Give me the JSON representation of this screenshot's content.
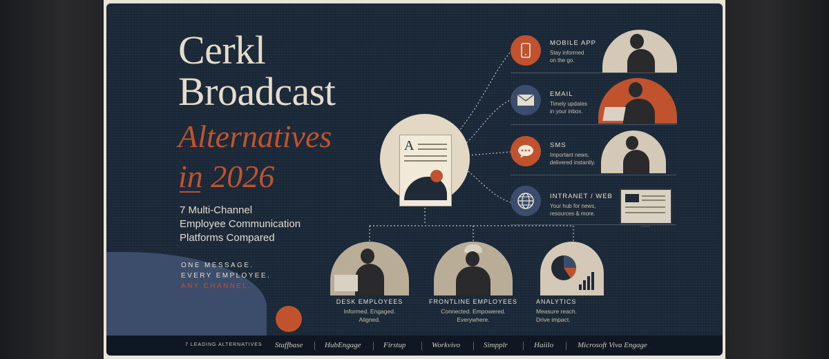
{
  "poster": {
    "title_line1": "Cerkl",
    "title_line2": "Broadcast",
    "title_italic1": "Alternatives",
    "title_italic2": "in 2026",
    "subtitle": [
      "7 Multi-Channel",
      "Employee Communication",
      "Platforms Compared"
    ],
    "tagline": [
      "ONE MESSAGE.",
      "EVERY EMPLOYEE.",
      "ANY CHANNEL."
    ],
    "hub_letter": "A"
  },
  "channels": [
    {
      "title": "MOBILE APP",
      "desc": [
        "Stay informed",
        "on the go."
      ],
      "icon": "phone-icon",
      "color": "#c0532d"
    },
    {
      "title": "EMAIL",
      "desc": [
        "Timely updates",
        "in your inbox."
      ],
      "icon": "envelope-icon",
      "color": "#3b4d6b"
    },
    {
      "title": "SMS",
      "desc": [
        "Important news,",
        "delivered instantly."
      ],
      "icon": "chat-bubble-icon",
      "color": "#c0532d"
    },
    {
      "title": "INTRANET / WEB",
      "desc": [
        "Your hub for news,",
        "resources & more."
      ],
      "icon": "globe-icon",
      "color": "#3b4d6b"
    }
  ],
  "audiences": [
    {
      "title": "DESK EMPLOYEES",
      "desc": [
        "Informed. Engaged.",
        "Aligned."
      ]
    },
    {
      "title": "FRONTLINE EMPLOYEES",
      "desc": [
        "Connected. Empowered.",
        "Everywhere."
      ]
    },
    {
      "title": "ANALYTICS",
      "desc": [
        "Measure reach.",
        "Drive impact."
      ]
    }
  ],
  "footer": {
    "label": "7 LEADING ALTERNATIVES",
    "brands": [
      "Staffbase",
      "HubEngage",
      "Firstup",
      "Workvivo",
      "Simpplr",
      "Haiilo",
      "Microsoft Viva Engage"
    ]
  },
  "colors": {
    "navy": "#1b2838",
    "orange": "#c0532d",
    "blue": "#3b4d6b",
    "cream": "#e4dccc"
  }
}
